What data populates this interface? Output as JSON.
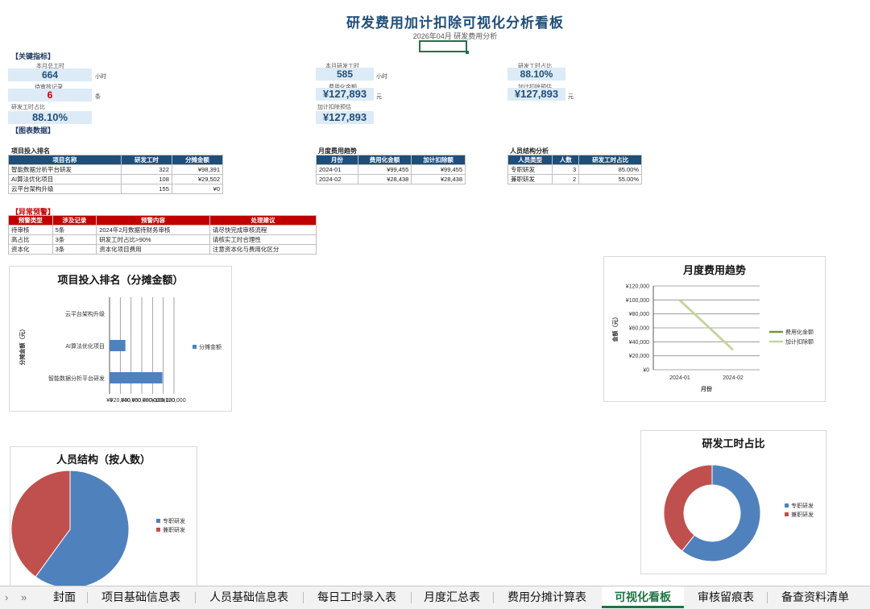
{
  "header": {
    "title": "研发费用加计扣除可视化分析看板",
    "subtitle": "2026年04月 研发费用分析"
  },
  "kpi": {
    "section": "【关键指标】",
    "month_hours": {
      "label": "本月总工时",
      "value": "664",
      "unit": "小时"
    },
    "rd_hours": {
      "label": "本月研发工时",
      "value": "585",
      "unit": "小时"
    },
    "rd_ratio_top": {
      "label": "研发工时占比",
      "value": "88.10%"
    },
    "pending": {
      "label": "待审核记录",
      "value": "6",
      "unit": "条"
    },
    "expensed": {
      "label": "费用化金额",
      "value": "¥127,893",
      "unit": "元"
    },
    "deduct_est": {
      "label": "加计扣除预估",
      "value": "¥127,893",
      "unit": "元"
    },
    "rd_ratio": {
      "label": "研发工时占比",
      "value": "88.10%"
    },
    "deduct_est2": {
      "label": "加计扣除预估",
      "value": "¥127,893"
    }
  },
  "chart_section": "【图表数据】",
  "tables": {
    "projects": {
      "label": "项目投入排名",
      "headers": [
        "项目名称",
        "研发工时",
        "分摊金额"
      ],
      "rows": [
        [
          "智能数据分析平台研发",
          "322",
          "¥98,391"
        ],
        [
          "AI算法优化项目",
          "108",
          "¥29,502"
        ],
        [
          "云平台架构升级",
          "155",
          "¥0"
        ]
      ]
    },
    "monthly": {
      "label": "月度费用趋势",
      "headers": [
        "月份",
        "费用化金额",
        "加计扣除额"
      ],
      "rows": [
        [
          "2024-01",
          "¥99,455",
          "¥99,455"
        ],
        [
          "2024-02",
          "¥28,438",
          "¥28,438"
        ]
      ]
    },
    "staff": {
      "label": "人员结构分析",
      "headers": [
        "人员类型",
        "人数",
        "研发工时占比"
      ],
      "rows": [
        [
          "专职研发",
          "3",
          "85.00%"
        ],
        [
          "兼职研发",
          "2",
          "55.00%"
        ]
      ]
    },
    "alerts": {
      "label": "【异常预警】",
      "headers": [
        "预警类型",
        "涉及记录",
        "预警内容",
        "处理建议"
      ],
      "rows": [
        [
          "待审核",
          "5条",
          "2024年2月数据待财务审核",
          "请尽快完成审核流程"
        ],
        [
          "高占比",
          "3条",
          "研发工时占比>90%",
          "请核实工时合理性"
        ],
        [
          "资本化",
          "3条",
          "资本化项目费用",
          "注意资本化与费用化区分"
        ]
      ]
    }
  },
  "chart_data": [
    {
      "type": "bar",
      "title": "项目投入排名（分摊金额）",
      "categories": [
        "智能数据分析平台研发",
        "AI算法优化项目",
        "云平台架构升级"
      ],
      "series": [
        {
          "name": "分摊金额",
          "values": [
            98391,
            29502,
            0
          ],
          "color": "#4f81bd"
        }
      ],
      "ylabel": "分摊金额（元）",
      "tick_labels": [
        "¥0",
        "¥20,000",
        "¥40,000",
        "¥60,000",
        "¥80,000",
        "¥100,000",
        "¥120,000"
      ],
      "xlim": [
        0,
        120000
      ],
      "legend": "right"
    },
    {
      "type": "line",
      "title": "月度费用趋势",
      "x": [
        "2024-01",
        "2024-02"
      ],
      "series": [
        {
          "name": "费用化金额",
          "values": [
            99455,
            28438
          ],
          "color": "#77933c"
        },
        {
          "name": "加计扣除额",
          "values": [
            99455,
            28438
          ],
          "color": "#c3d69b"
        }
      ],
      "xlabel": "月份",
      "ylabel": "金额（元）",
      "ylim": [
        0,
        120000
      ],
      "tick_labels": [
        "¥0",
        "¥20,000",
        "¥40,000",
        "¥60,000",
        "¥80,000",
        "¥100,000",
        "¥120,000"
      ],
      "grid": true,
      "legend": "right"
    },
    {
      "type": "pie",
      "title": "人员结构（按人数）",
      "labels": [
        "专职研发",
        "兼职研发"
      ],
      "values": [
        3,
        2
      ],
      "colors": [
        "#4f81bd",
        "#c0504d"
      ],
      "legend": "right"
    },
    {
      "type": "pie",
      "title": "研发工时占比",
      "labels": [
        "专职研发",
        "兼职研发"
      ],
      "values": [
        85,
        55
      ],
      "colors": [
        "#4f81bd",
        "#c0504d"
      ],
      "donut": true,
      "legend": "right"
    }
  ],
  "sheet_tabs": {
    "nav_prev": "›",
    "nav_last": "»",
    "items": [
      "封面",
      "项目基础信息表",
      "人员基础信息表",
      "每日工时录入表",
      "月度汇总表",
      "费用分摊计算表",
      "可视化看板",
      "审核留痕表",
      "备查资料清单"
    ],
    "active": "可视化看板"
  }
}
